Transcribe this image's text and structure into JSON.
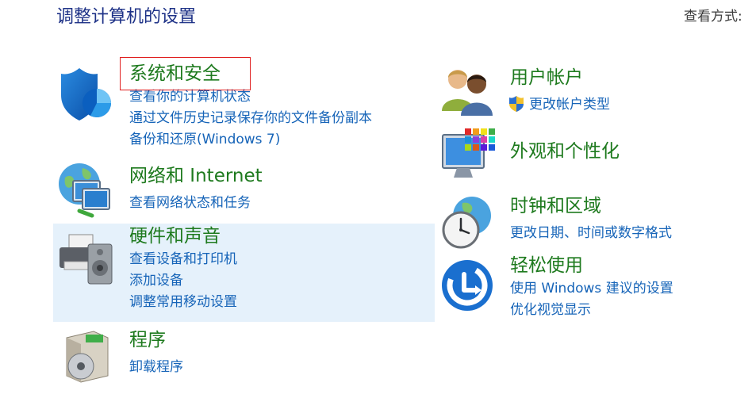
{
  "header": {
    "title": "调整计算机的设置",
    "view_by_label": "查看方式:"
  },
  "categories": {
    "system_security": {
      "title": "系统和安全",
      "links": [
        "查看你的计算机状态",
        "通过文件历史记录保存你的文件备份副本",
        "备份和还原(Windows 7)"
      ]
    },
    "network": {
      "title": "网络和 Internet",
      "links": [
        "查看网络状态和任务"
      ]
    },
    "hardware": {
      "title": "硬件和声音",
      "links": [
        "查看设备和打印机",
        "添加设备",
        "调整常用移动设置"
      ]
    },
    "programs": {
      "title": "程序",
      "links": [
        "卸载程序"
      ]
    },
    "user_accounts": {
      "title": "用户帐户",
      "links": [
        "更改帐户类型"
      ]
    },
    "appearance": {
      "title": "外观和个性化",
      "links": []
    },
    "clock_region": {
      "title": "时钟和区域",
      "links": [
        "更改日期、时间或数字格式"
      ]
    },
    "ease_access": {
      "title": "轻松使用",
      "links": [
        "使用 Windows 建议的设置",
        "优化视觉显示"
      ]
    }
  },
  "colors": {
    "category_title": "#1e7a1e",
    "link": "#1664b8",
    "page_title": "#1e3287",
    "hover_background": "#e5f1fb",
    "focus_border": "#e02020"
  },
  "icons": {
    "system_security": "shield-chart-icon",
    "network": "globe-monitors-icon",
    "hardware": "printer-speaker-icon",
    "programs": "program-disc-icon",
    "user_accounts": "users-icon",
    "appearance": "monitor-palette-icon",
    "clock_region": "clock-globe-icon",
    "ease_access": "ease-of-access-icon",
    "uac": "uac-shield-icon"
  }
}
